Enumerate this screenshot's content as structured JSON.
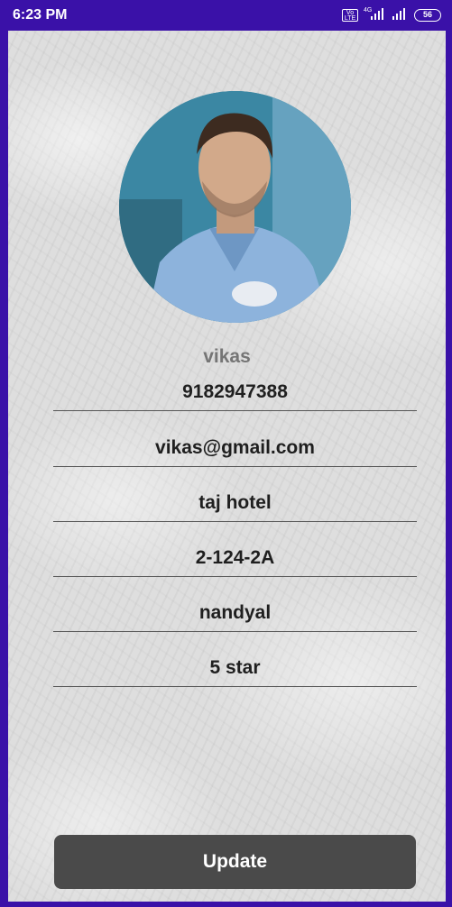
{
  "status_bar": {
    "time": "6:23 PM",
    "volte_label": "Vo LTE",
    "network_label": "4G",
    "battery_level": "56",
    "icons": [
      "volte-icon",
      "signal-4g-icon",
      "signal-icon",
      "battery-icon"
    ]
  },
  "profile": {
    "avatar": "profile-photo",
    "name": "vikas"
  },
  "fields": [
    {
      "key": "phone",
      "value": "9182947388"
    },
    {
      "key": "email",
      "value": "vikas@gmail.com"
    },
    {
      "key": "hotel_name",
      "value": "taj hotel"
    },
    {
      "key": "address",
      "value": "2-124-2A"
    },
    {
      "key": "city",
      "value": "nandyal"
    },
    {
      "key": "rating",
      "value": "5 star"
    }
  ],
  "actions": {
    "update_label": "Update"
  },
  "colors": {
    "status_bar": "#3a11a8",
    "button": "#4a4a4a",
    "name_text": "#757575",
    "field_text": "#1f1f1f",
    "underline": "#555555"
  }
}
